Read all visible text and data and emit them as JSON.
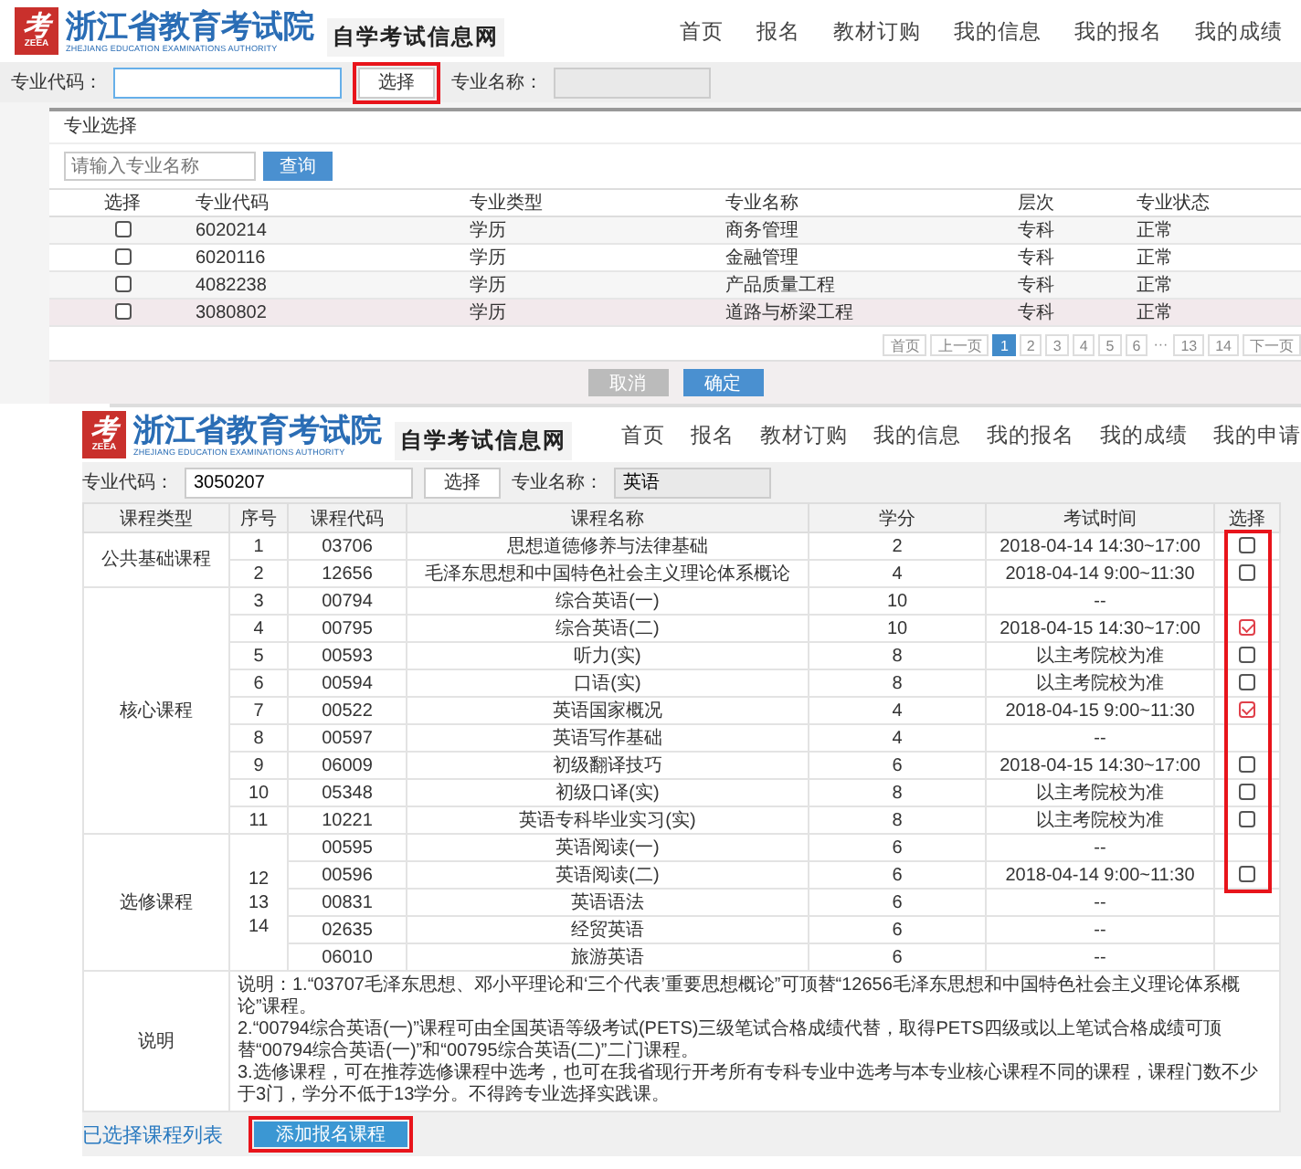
{
  "top_screen": {
    "header": {
      "logo_mark": "考",
      "logo_caption": "ZEEA",
      "title": "浙江省教育考试院",
      "subtitle": "ZHEJIANG EDUCATION EXAMINATIONS AUTHORITY",
      "site_name": "自学考试信息网",
      "nav": [
        "首页",
        "报名",
        "教材订购",
        "我的信息",
        "我的报名",
        "我的成绩"
      ]
    },
    "form": {
      "code_label": "专业代码：",
      "code_focused": true,
      "select_button": {
        "label": "选择",
        "highlighted": true
      },
      "name_label": "专业名称："
    },
    "dialog": {
      "title": "专业选择",
      "search": {
        "placeholder": "请输入专业名称"
      },
      "search_button": "查询",
      "columns": [
        "选择",
        "专业代码",
        "专业类型",
        "专业名称",
        "层次",
        "专业状态"
      ],
      "rows": [
        {
          "checked": false,
          "hovered": false,
          "code": "6020214",
          "type": "学历",
          "name": "商务管理",
          "level": "专科",
          "status": "正常"
        },
        {
          "checked": false,
          "hovered": false,
          "code": "6020116",
          "type": "学历",
          "name": "金融管理",
          "level": "专科",
          "status": "正常"
        },
        {
          "checked": false,
          "hovered": false,
          "code": "4082238",
          "type": "学历",
          "name": "产品质量工程",
          "level": "专科",
          "status": "正常"
        },
        {
          "checked": false,
          "hovered": true,
          "code": "3080802",
          "type": "学历",
          "name": "道路与桥梁工程",
          "level": "专科",
          "status": "正常"
        }
      ],
      "pagination": [
        {
          "label": "首页",
          "selected": false
        },
        {
          "label": "上一页",
          "selected": false
        },
        {
          "label": "1",
          "selected": true
        },
        {
          "label": "2",
          "selected": false
        },
        {
          "label": "3",
          "selected": false
        },
        {
          "label": "4",
          "selected": false
        },
        {
          "label": "5",
          "selected": false
        },
        {
          "label": "6",
          "selected": false
        },
        {
          "label": "···",
          "selected": false,
          "kind": "gap"
        },
        {
          "label": "13",
          "selected": false
        },
        {
          "label": "14",
          "selected": false
        },
        {
          "label": "下一页",
          "selected": false
        }
      ],
      "buttons": [
        {
          "label": "取消",
          "kind": "cancel"
        },
        {
          "label": "确定",
          "kind": "confirm"
        }
      ]
    }
  },
  "bottom_screen": {
    "header": {
      "logo_mark": "考",
      "logo_caption": "ZEEA",
      "title": "浙江省教育考试院",
      "subtitle": "ZHEJIANG EDUCATION EXAMINATIONS AUTHORITY",
      "site_name": "自学考试信息网",
      "nav": [
        "首页",
        "报名",
        "教材订购",
        "我的信息",
        "我的报名",
        "我的成绩",
        "我的申请"
      ]
    },
    "form": {
      "code_label": "专业代码：",
      "code_value": "3050207",
      "select_button": {
        "label": "选择",
        "highlighted": false
      },
      "name_label": "专业名称：",
      "name_value": "英语"
    },
    "course_table": {
      "highlight_select_column": true,
      "columns": [
        "课程类型",
        "序号",
        "课程代码",
        "课程名称",
        "学分",
        "考试时间",
        "选择"
      ],
      "groups": [
        {
          "type": "公共基础课程",
          "rows": [
            {
              "seq": "1",
              "code": "03706",
              "name": "思想道德修养与法律基础",
              "credit": "2",
              "time": "2018-04-14 14:30~17:00",
              "selectable": true,
              "checked": false
            },
            {
              "seq": "2",
              "code": "12656",
              "name": "毛泽东思想和中国特色社会主义理论体系概论",
              "credit": "4",
              "time": "2018-04-14 9:00~11:30",
              "selectable": true,
              "checked": false
            }
          ]
        },
        {
          "type": "核心课程",
          "rows": [
            {
              "seq": "3",
              "code": "00794",
              "name": "综合英语(一)",
              "credit": "10",
              "time": "--",
              "selectable": false
            },
            {
              "seq": "4",
              "code": "00795",
              "name": "综合英语(二)",
              "credit": "10",
              "time": "2018-04-15 14:30~17:00",
              "selectable": true,
              "checked": true
            },
            {
              "seq": "5",
              "code": "00593",
              "name": "听力(实)",
              "credit": "8",
              "time": "以主考院校为准",
              "selectable": true,
              "checked": false
            },
            {
              "seq": "6",
              "code": "00594",
              "name": "口语(实)",
              "credit": "8",
              "time": "以主考院校为准",
              "selectable": true,
              "checked": false
            },
            {
              "seq": "7",
              "code": "00522",
              "name": "英语国家概况",
              "credit": "4",
              "time": "2018-04-15 9:00~11:30",
              "selectable": true,
              "checked": true
            },
            {
              "seq": "8",
              "code": "00597",
              "name": "英语写作基础",
              "credit": "4",
              "time": "--",
              "selectable": false
            },
            {
              "seq": "9",
              "code": "06009",
              "name": "初级翻译技巧",
              "credit": "6",
              "time": "2018-04-15 14:30~17:00",
              "selectable": true,
              "checked": false
            },
            {
              "seq": "10",
              "code": "05348",
              "name": "初级口译(实)",
              "credit": "8",
              "time": "以主考院校为准",
              "selectable": true,
              "checked": false
            },
            {
              "seq": "11",
              "code": "10221",
              "name": "英语专科毕业实习(实)",
              "credit": "8",
              "time": "以主考院校为准",
              "selectable": true,
              "checked": false
            }
          ]
        },
        {
          "type": "选修课程",
          "seq_lines": [
            "12",
            "13",
            "14"
          ],
          "rows": [
            {
              "code": "00595",
              "name": "英语阅读(一)",
              "credit": "6",
              "time": "--",
              "selectable": false
            },
            {
              "code": "00596",
              "name": "英语阅读(二)",
              "credit": "6",
              "time": "2018-04-14 9:00~11:30",
              "selectable": true,
              "checked": false
            },
            {
              "code": "00831",
              "name": "英语语法",
              "credit": "6",
              "time": "--",
              "selectable": false
            },
            {
              "code": "02635",
              "name": "经贸英语",
              "credit": "6",
              "time": "--",
              "selectable": false
            },
            {
              "code": "06010",
              "name": "旅游英语",
              "credit": "6",
              "time": "--",
              "selectable": false
            }
          ]
        }
      ],
      "note": {
        "label": "说明",
        "lines": [
          "说明：1.“03707毛泽东思想、邓小平理论和‘三个代表’重要思想概论”可顶替“12656毛泽东思想和中国特色社会主义理论体系概论”课程。",
          "2.“00794综合英语(一)”课程可由全国英语等级考试(PETS)三级笔试合格成绩代替，取得PETS四级或以上笔试合格成绩可顶替“00794综合英语(一)”和“00795综合英语(二)”二门课程。",
          "3.选修课程，可在推荐选修课程中选考，也可在我省现行开考所有专科专业中选考与本专业核心课程不同的课程，课程门数不少于3门，学分不低于13学分。不得跨专业选择实践课。"
        ]
      }
    },
    "selected_list_title": "已选择课程列表",
    "add_button": {
      "label": "添加报名课程",
      "highlighted": true
    }
  }
}
